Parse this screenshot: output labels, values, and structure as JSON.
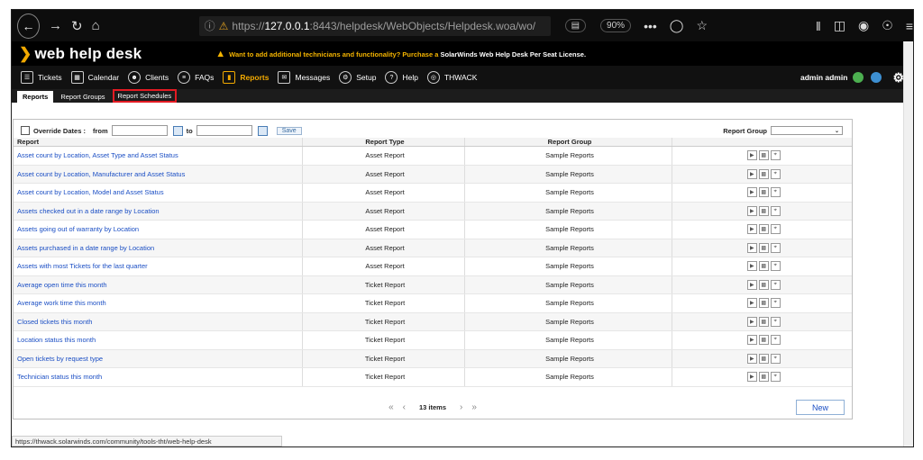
{
  "browser": {
    "back_icon": "back-arrow",
    "url_prefix": "https://",
    "url_host": "127.0.0.1",
    "url_rest": ":8443/helpdesk/WebObjects/Helpdesk.woa/wo/",
    "zoom": "90%",
    "more": "•••"
  },
  "app": {
    "logo": "web help desk",
    "banner_text": "Want to add additional technicians and functionality? Purchase a",
    "banner_link": "SolarWinds Web Help Desk Per Seat License.",
    "user": "admin admin"
  },
  "nav": {
    "items": [
      {
        "label": "Tickets"
      },
      {
        "label": "Calendar"
      },
      {
        "label": "Clients"
      },
      {
        "label": "FAQs"
      },
      {
        "label": "Reports"
      },
      {
        "label": "Messages"
      },
      {
        "label": "Setup"
      },
      {
        "label": "Help"
      },
      {
        "label": "THWACK"
      }
    ]
  },
  "subtabs": {
    "reports": "Reports",
    "groups": "Report Groups",
    "schedules": "Report Schedules"
  },
  "filter": {
    "override": "Override Dates :",
    "from": "from",
    "to": "to",
    "save": "Save",
    "report_group": "Report Group"
  },
  "table": {
    "headers": [
      "Report",
      "Report Type",
      "Report Group"
    ],
    "rows": [
      [
        "Asset count by Location, Asset Type and Asset Status",
        "Asset Report",
        "Sample Reports"
      ],
      [
        "Asset count by Location, Manufacturer and Asset Status",
        "Asset Report",
        "Sample Reports"
      ],
      [
        "Asset count by Location, Model and Asset Status",
        "Asset Report",
        "Sample Reports"
      ],
      [
        "Assets checked out in a date range by Location",
        "Asset Report",
        "Sample Reports"
      ],
      [
        "Assets going out of warranty by Location",
        "Asset Report",
        "Sample Reports"
      ],
      [
        "Assets purchased in a date range by Location",
        "Asset Report",
        "Sample Reports"
      ],
      [
        "Assets with most Tickets for the last quarter",
        "Asset Report",
        "Sample Reports"
      ],
      [
        "Average open time this month",
        "Ticket Report",
        "Sample Reports"
      ],
      [
        "Average work time this month",
        "Ticket Report",
        "Sample Reports"
      ],
      [
        "Closed tickets this month",
        "Ticket Report",
        "Sample Reports"
      ],
      [
        "Location status this month",
        "Ticket Report",
        "Sample Reports"
      ],
      [
        "Open tickets by request type",
        "Ticket Report",
        "Sample Reports"
      ],
      [
        "Technician status this month",
        "Ticket Report",
        "Sample Reports"
      ]
    ]
  },
  "pager": {
    "count": "13 items",
    "first": "«",
    "prev": "‹",
    "next": "›",
    "last": "»"
  },
  "new_button": "New",
  "status_url": "https://thwack.solarwinds.com/community/tools-tht/web-help-desk"
}
